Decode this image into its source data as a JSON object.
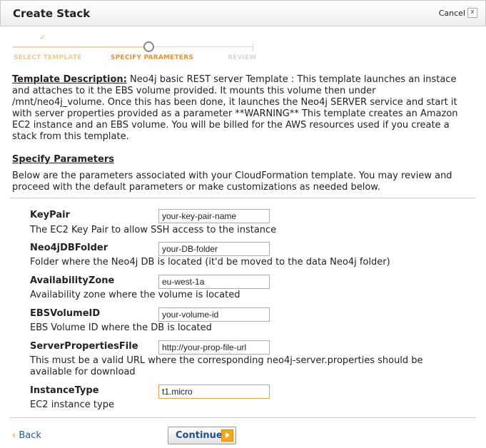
{
  "dialog": {
    "title": "Create Stack",
    "cancel_label": "Cancel",
    "close_label": "x"
  },
  "wizard": {
    "steps": [
      "SELECT TEMPLATE",
      "SPECIFY PARAMETERS",
      "REVIEW"
    ],
    "completed_mark": "✓",
    "current_step": 2
  },
  "template": {
    "label": "Template Description:",
    "text": "Neo4j basic REST server Template : This template launches an instace and attaches to it the EBS volume provided. It mounts this volume then under /mnt/neo4j_volume. Once this has been done, it launches the Neo4j SERVER service and start it with server properties provided as a parameter **WARNING** This template creates an Amazon EC2 instance and an EBS volume. You will be billed for the AWS resources used if you create a stack from this template."
  },
  "params_section": {
    "title": "Specify Parameters",
    "text": "Below are the parameters associated with your CloudFormation template. You may review and proceed with the default parameters or make customizations as needed below."
  },
  "params": [
    {
      "name": "KeyPair",
      "value": "your-key-pair-name",
      "description": "The EC2 Key Pair to allow SSH access to the instance"
    },
    {
      "name": "Neo4jDBFolder",
      "value": "your-DB-folder",
      "description": "Folder where the Neo4j DB is located (it'd be moved to the data Neo4j folder)"
    },
    {
      "name": "AvailabilityZone",
      "value": "eu-west-1a",
      "description": "Availability zone where the volume is located"
    },
    {
      "name": "EBSVolumeID",
      "value": "your-volume-id",
      "description": "EBS Volume ID where the DB is located"
    },
    {
      "name": "ServerPropertiesFile",
      "value": "http://your-prop-file-url",
      "description": "This must be a valid URL where the corresponding neo4j-server.properties should be available for download"
    },
    {
      "name": "InstanceType",
      "value": "t1.micro",
      "description": "EC2 instance type"
    }
  ],
  "footer": {
    "back_chevron": "‹",
    "back_label": "Back",
    "continue_label": "Continue"
  },
  "colors": {
    "accent_orange": "#e0922c",
    "link_blue": "#1f5fa8",
    "button_arrow": "#f2a81c"
  }
}
